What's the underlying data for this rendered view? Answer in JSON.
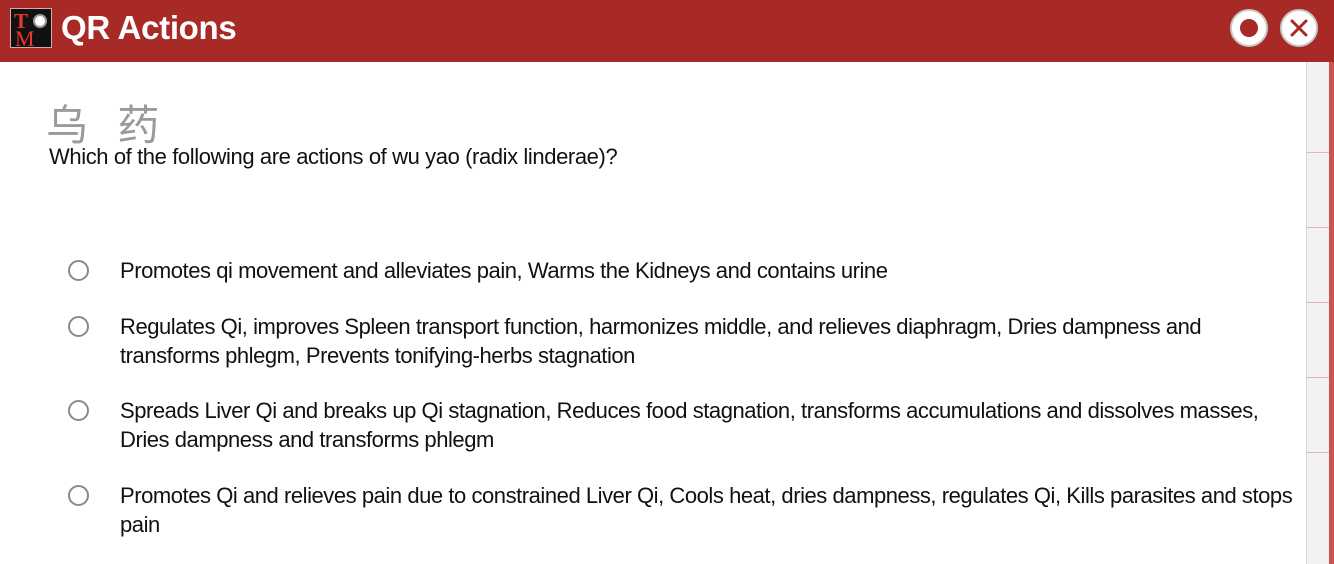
{
  "window": {
    "title": "QR Actions",
    "logo_icon": "tcm-tests-logo-icon",
    "record_icon": "record-icon",
    "close_icon": "close-icon"
  },
  "question": {
    "chinese_name": "乌 药",
    "text": "Which of the following are actions of wu yao (radix linderae)?"
  },
  "options": [
    {
      "label": "Promotes qi movement and alleviates pain, Warms the Kidneys and contains urine"
    },
    {
      "label": "Regulates Qi, improves Spleen transport function, harmonizes middle, and relieves diaphragm, Dries dampness and transforms phlegm, Prevents tonifying-herbs stagnation"
    },
    {
      "label": "Spreads Liver Qi and breaks up Qi stagnation, Reduces food stagnation, transforms accumulations and dissolves masses, Dries dampness and transforms phlegm"
    },
    {
      "label": "Promotes Qi and relieves pain due to constrained Liver Qi, Cools heat, dries dampness, regulates Qi, Kills parasites and stops pain"
    }
  ],
  "colors": {
    "titlebar": "#a82a26",
    "divider": "#a82a26",
    "radio_border": "#8a8a8a"
  }
}
